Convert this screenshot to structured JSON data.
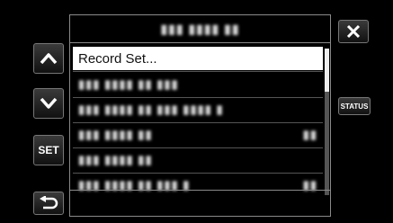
{
  "menu": {
    "title": "▮▮▮ ▮▮▮▮ ▮▮",
    "items": [
      {
        "label": "Record Set...",
        "value": ""
      },
      {
        "label": "▮▮▮ ▮▮▮▮ ▮▮ ▮▮▮",
        "value": ""
      },
      {
        "label": "▮▮▮ ▮▮▮▮ ▮▮ ▮▮▮ ▮▮▮▮ ▮",
        "value": ""
      },
      {
        "label": "▮▮▮ ▮▮▮▮ ▮▮",
        "value": "▮▮"
      },
      {
        "label": "▮▮▮ ▮▮▮▮ ▮▮",
        "value": ""
      },
      {
        "label": "▮▮▮ ▮▮▮▮ ▮▮ ▮▮▮ ▮",
        "value": "▮▮"
      }
    ],
    "selected_index": 0,
    "scroll_fraction": 0.3
  },
  "buttons": {
    "up": "up-arrow-icon",
    "down": "down-arrow-icon",
    "set_label": "SET",
    "close": "close-icon",
    "status_label": "STATUS",
    "back": "back-arrow-icon"
  }
}
